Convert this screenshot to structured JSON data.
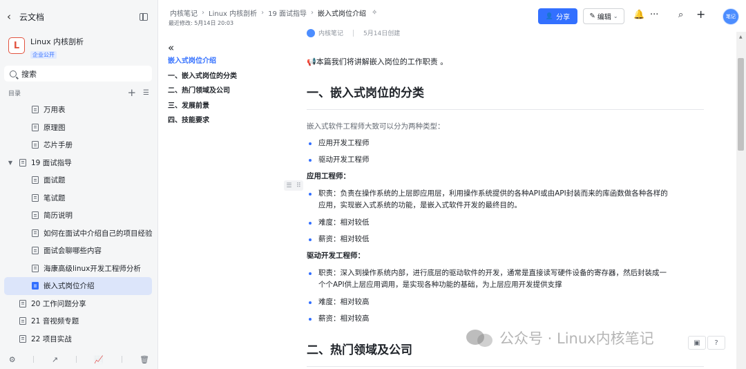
{
  "sidebar": {
    "back_label": "云文档",
    "kb": {
      "logo": "L",
      "name": "Linux 内核剖析",
      "badge": "企业公开"
    },
    "search_placeholder": "搜索",
    "toc_label": "目录",
    "items": [
      {
        "label": "万用表",
        "level": 2
      },
      {
        "label": "原理图",
        "level": 2
      },
      {
        "label": "芯片手册",
        "level": 2
      },
      {
        "label": "19 面试指导",
        "level": 1,
        "expanded": true
      },
      {
        "label": "面试题",
        "level": 2
      },
      {
        "label": "笔试题",
        "level": 2
      },
      {
        "label": "简历说明",
        "level": 2
      },
      {
        "label": "如何在面试中介绍自己的项目经验",
        "level": 2
      },
      {
        "label": "面试会聊哪些内容",
        "level": 2
      },
      {
        "label": "海康高级linux开发工程师分析",
        "level": 2
      },
      {
        "label": "嵌入式岗位介绍",
        "level": 2,
        "active": true
      },
      {
        "label": "20 工作问题分享",
        "level": 1
      },
      {
        "label": "21 音视频专题",
        "level": 1
      },
      {
        "label": "22 项目实战",
        "level": 1
      }
    ]
  },
  "header": {
    "breadcrumbs": [
      "内核笔记",
      "Linux 内核剖析",
      "19 面试指导",
      "嵌入式岗位介绍"
    ],
    "modified": "最近修改: 5月14日 20:03",
    "share_label": "分享",
    "edit_label": "编辑",
    "avatar_text": "笔记"
  },
  "outline": {
    "items": [
      "嵌入式岗位介绍",
      "一、嵌入式岗位的分类",
      "二、热门领域及公司",
      "三、发展前景",
      "四、技能要求"
    ]
  },
  "doc": {
    "meta_author": "内核笔记",
    "meta_created": "5月14日创建",
    "intro": "📢本篇我们将讲解嵌入岗位的工作职责 。",
    "h1_a": "一、嵌入式岗位的分类",
    "lead": "嵌入式软件工程师大致可以分为两种类型：",
    "type_1": "应用开发工程师",
    "type_2": "驱动开发工程师",
    "app_title": "应用工程师：",
    "app_duty_1": "职责：负责在操作系统的上层即应用层，利用操作系统提供的各种API或由API封装而来的库函数做各种各样的",
    "app_duty_2": "应用，实现嵌入式系统的功能，是嵌入式软件开发的最终目的。",
    "app_difficulty": "难度：相对较低",
    "app_salary": "薪资：相对较低",
    "drv_title": "驱动开发工程师：",
    "drv_duty_1": "职责：深入到操作系统内部，进行底层的驱动软件的开发，通常是直接读写硬件设备的寄存器，然后封装成一",
    "drv_duty_2": "个个API供上层应用调用，是实现各种功能的基础，为上层应用开发提供支撑",
    "drv_difficulty": "难度：相对较高",
    "drv_salary": "薪资：相对较高",
    "h1_b": "二、热门领域及公司"
  },
  "watermark": "公众号 · Linux内核笔记",
  "colors": {
    "accent": "#3370ff",
    "logo_red": "#e2533f",
    "active_bg": "#dce5fa"
  }
}
